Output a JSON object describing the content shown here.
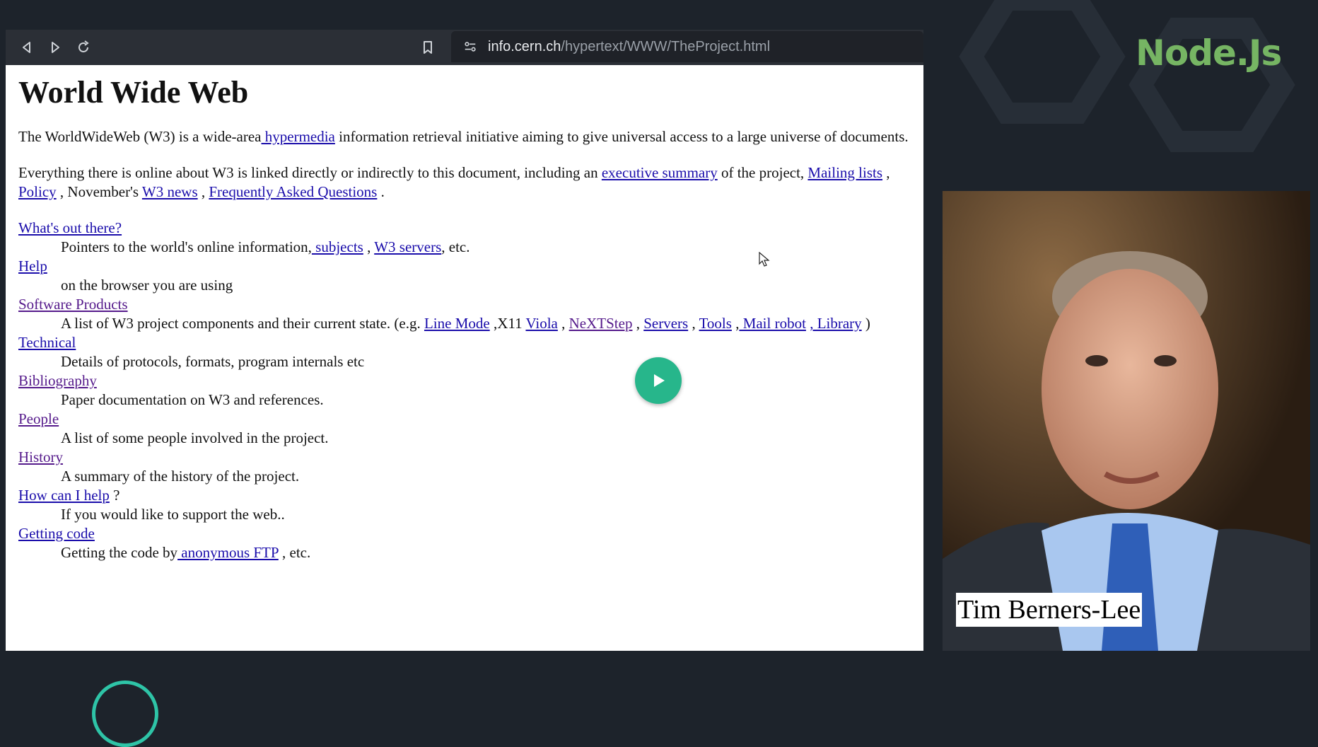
{
  "browser": {
    "url_host": "info.cern.ch",
    "url_path": "/hypertext/WWW/TheProject.html",
    "icons": {
      "back": "back-icon",
      "forward": "forward-icon",
      "reload": "reload-icon",
      "bookmark": "bookmark-icon",
      "site": "site-settings-icon"
    }
  },
  "page": {
    "title": "World Wide Web",
    "intro": {
      "text1": "The WorldWideWeb (W3) is a wide-area",
      "link": " hypermedia",
      "text2": " information retrieval initiative aiming to give universal access to a large universe of documents."
    },
    "summary": {
      "text1": "Everything there is online about W3 is linked directly or indirectly to this document, including an ",
      "link_exec": "executive summary",
      "text2": " of the project, ",
      "link_mailing": "Mailing lists",
      "sep1": " , ",
      "link_policy": "Policy",
      "text3": " , November's ",
      "link_news": "W3 news",
      "sep2": " , ",
      "link_faq": "Frequently Asked Questions",
      "end": " ."
    },
    "items": [
      {
        "term": "What's out there?",
        "pre": "Pointers to the world's online information,",
        "l1": " subjects",
        "s1": " , ",
        "l2": "W3 servers",
        "post": ", etc."
      },
      {
        "term": "Help",
        "desc": "on the browser you are using"
      },
      {
        "term": "Software Products",
        "pre": "A list of W3 project components and their current state. (e.g. ",
        "l1": "Line Mode",
        "s1": " ,X11 ",
        "l2": "Viola",
        "s2": " , ",
        "l3": "NeXTStep",
        "s3": " , ",
        "l4": "Servers",
        "s4": " , ",
        "l5": "Tools",
        "s5": " ,",
        "l6": " Mail robot",
        "s6": " ",
        "l7": ", Library",
        "post": " )"
      },
      {
        "term": "Technical",
        "desc": "Details of protocols, formats, program internals etc"
      },
      {
        "term": "Bibliography",
        "desc": "Paper documentation on W3 and references."
      },
      {
        "term": "People",
        "desc": "A list of some people involved in the project."
      },
      {
        "term": "History",
        "desc": "A summary of the history of the project."
      },
      {
        "term": "How can I help",
        "term_suffix": " ?",
        "desc": "If you would like to support the web.."
      },
      {
        "term": "Getting code",
        "pre": "Getting the code by",
        "l1": " anonymous FTP",
        "post": " , etc."
      }
    ]
  },
  "overlay": {
    "play_icon": "play-icon",
    "cursor_icon": "mouse-cursor-icon"
  },
  "sidebar": {
    "logo": "Node.Js",
    "speaker_name": "Tim Berners-Lee"
  },
  "colors": {
    "accent_green": "#27b68b",
    "logo_green": "#76b563",
    "link_blue": "#1a0dab",
    "visited": "#551a8b"
  }
}
